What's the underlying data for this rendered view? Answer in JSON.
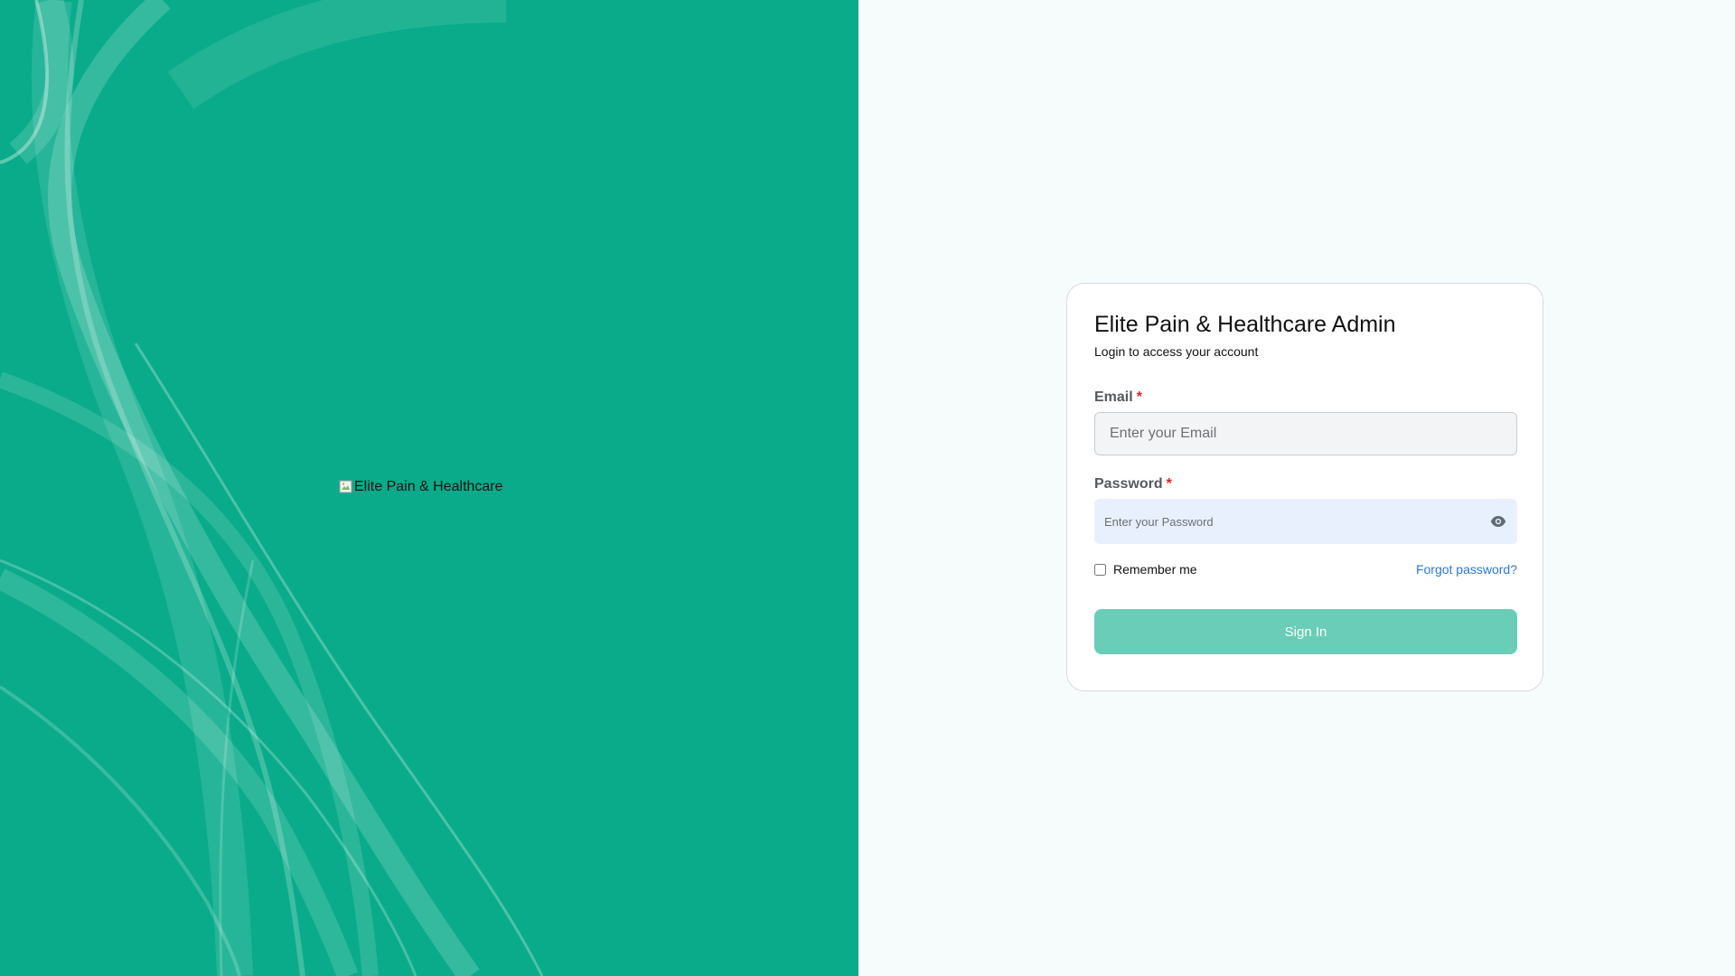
{
  "brand": {
    "logo_alt": "Elite Pain & Healthcare",
    "accent_color": "#09ab8a"
  },
  "login_card": {
    "title": "Elite Pain & Healthcare Admin",
    "subtitle": "Login to access your account",
    "email": {
      "label": "Email",
      "required_mark": "*",
      "placeholder": "Enter your Email",
      "value": ""
    },
    "password": {
      "label": "Password",
      "required_mark": "*",
      "placeholder": "Enter your Password",
      "value": "",
      "toggle_icon": "eye-icon"
    },
    "remember_me": {
      "label": "Remember me",
      "checked": false
    },
    "forgot_password_label": "Forgot password?",
    "sign_in_label": "Sign In",
    "button_color": "#6acdb7",
    "link_color": "#2c77d9"
  }
}
